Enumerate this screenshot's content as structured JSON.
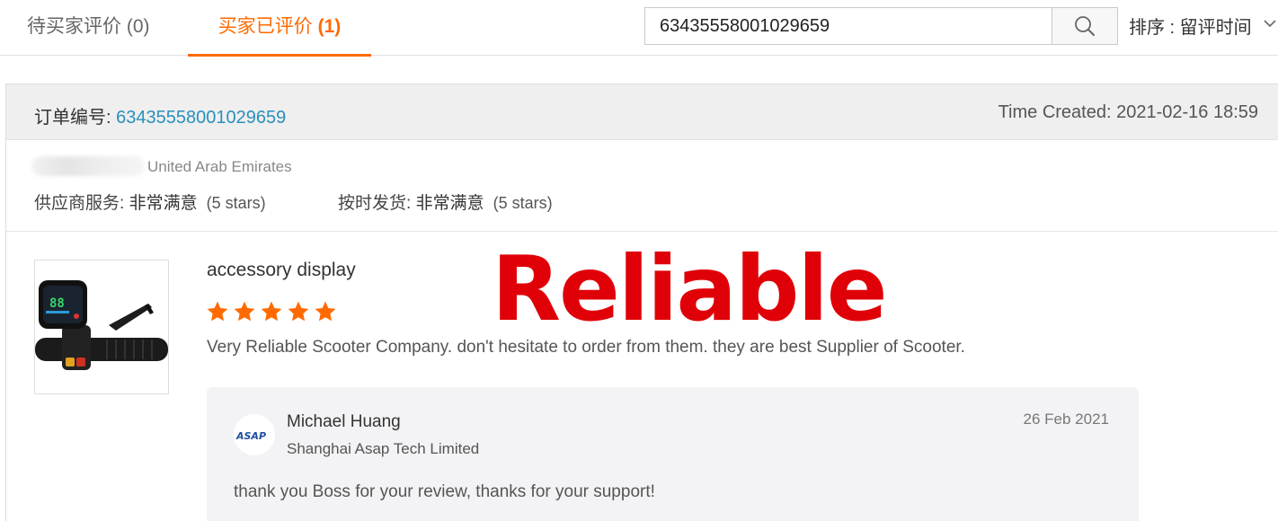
{
  "tabs": [
    {
      "label": "待买家评价",
      "count": "(0)"
    },
    {
      "label": "买家已评价",
      "count": "(1)"
    }
  ],
  "search": {
    "value": "63435558001029659"
  },
  "sort": {
    "label": "排序 : 留评时间"
  },
  "order": {
    "no_label": "订单编号: ",
    "no_value": "63435558001029659",
    "time_created": "Time Created: 2021-02-16 18:59"
  },
  "buyer": {
    "country": "United Arab Emirates",
    "ratings": [
      {
        "label": "供应商服务: ",
        "value": "非常满意",
        "stars": "(5 stars)"
      },
      {
        "label": "按时发货: ",
        "value": "非常满意",
        "stars": "(5 stars)"
      }
    ]
  },
  "review": {
    "product_title": "accessory display",
    "star_count": 5,
    "star_color": "#ff6a00",
    "text": "Very Reliable Scooter Company. don't hesitate to order from them. they are best Supplier of Scooter.",
    "stamp": "Reliable",
    "stamp_color": "#e00008"
  },
  "reply": {
    "avatar_text": "ASAP",
    "name": "Michael Huang",
    "company": "Shanghai Asap Tech Limited",
    "date": "26 Feb 2021",
    "text": "thank you Boss for your review, thanks for your support!"
  },
  "colors": {
    "accent": "#ff6a00",
    "link": "#2a8fbd"
  }
}
